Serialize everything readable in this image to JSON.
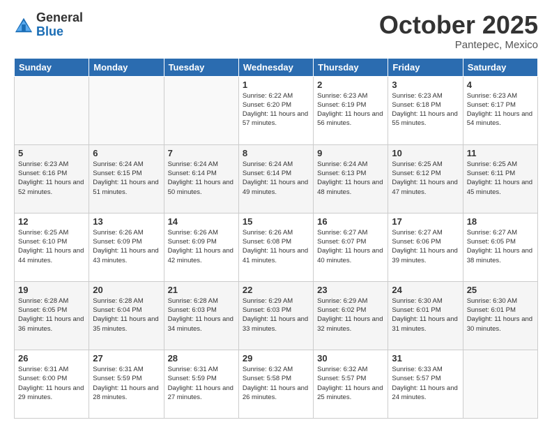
{
  "logo": {
    "general": "General",
    "blue": "Blue"
  },
  "header": {
    "month": "October 2025",
    "location": "Pantepec, Mexico"
  },
  "weekdays": [
    "Sunday",
    "Monday",
    "Tuesday",
    "Wednesday",
    "Thursday",
    "Friday",
    "Saturday"
  ],
  "weeks": [
    [
      {
        "day": "",
        "sunrise": "",
        "sunset": "",
        "daylight": ""
      },
      {
        "day": "",
        "sunrise": "",
        "sunset": "",
        "daylight": ""
      },
      {
        "day": "",
        "sunrise": "",
        "sunset": "",
        "daylight": ""
      },
      {
        "day": "1",
        "sunrise": "Sunrise: 6:22 AM",
        "sunset": "Sunset: 6:20 PM",
        "daylight": "Daylight: 11 hours and 57 minutes."
      },
      {
        "day": "2",
        "sunrise": "Sunrise: 6:23 AM",
        "sunset": "Sunset: 6:19 PM",
        "daylight": "Daylight: 11 hours and 56 minutes."
      },
      {
        "day": "3",
        "sunrise": "Sunrise: 6:23 AM",
        "sunset": "Sunset: 6:18 PM",
        "daylight": "Daylight: 11 hours and 55 minutes."
      },
      {
        "day": "4",
        "sunrise": "Sunrise: 6:23 AM",
        "sunset": "Sunset: 6:17 PM",
        "daylight": "Daylight: 11 hours and 54 minutes."
      }
    ],
    [
      {
        "day": "5",
        "sunrise": "Sunrise: 6:23 AM",
        "sunset": "Sunset: 6:16 PM",
        "daylight": "Daylight: 11 hours and 52 minutes."
      },
      {
        "day": "6",
        "sunrise": "Sunrise: 6:24 AM",
        "sunset": "Sunset: 6:15 PM",
        "daylight": "Daylight: 11 hours and 51 minutes."
      },
      {
        "day": "7",
        "sunrise": "Sunrise: 6:24 AM",
        "sunset": "Sunset: 6:14 PM",
        "daylight": "Daylight: 11 hours and 50 minutes."
      },
      {
        "day": "8",
        "sunrise": "Sunrise: 6:24 AM",
        "sunset": "Sunset: 6:14 PM",
        "daylight": "Daylight: 11 hours and 49 minutes."
      },
      {
        "day": "9",
        "sunrise": "Sunrise: 6:24 AM",
        "sunset": "Sunset: 6:13 PM",
        "daylight": "Daylight: 11 hours and 48 minutes."
      },
      {
        "day": "10",
        "sunrise": "Sunrise: 6:25 AM",
        "sunset": "Sunset: 6:12 PM",
        "daylight": "Daylight: 11 hours and 47 minutes."
      },
      {
        "day": "11",
        "sunrise": "Sunrise: 6:25 AM",
        "sunset": "Sunset: 6:11 PM",
        "daylight": "Daylight: 11 hours and 45 minutes."
      }
    ],
    [
      {
        "day": "12",
        "sunrise": "Sunrise: 6:25 AM",
        "sunset": "Sunset: 6:10 PM",
        "daylight": "Daylight: 11 hours and 44 minutes."
      },
      {
        "day": "13",
        "sunrise": "Sunrise: 6:26 AM",
        "sunset": "Sunset: 6:09 PM",
        "daylight": "Daylight: 11 hours and 43 minutes."
      },
      {
        "day": "14",
        "sunrise": "Sunrise: 6:26 AM",
        "sunset": "Sunset: 6:09 PM",
        "daylight": "Daylight: 11 hours and 42 minutes."
      },
      {
        "day": "15",
        "sunrise": "Sunrise: 6:26 AM",
        "sunset": "Sunset: 6:08 PM",
        "daylight": "Daylight: 11 hours and 41 minutes."
      },
      {
        "day": "16",
        "sunrise": "Sunrise: 6:27 AM",
        "sunset": "Sunset: 6:07 PM",
        "daylight": "Daylight: 11 hours and 40 minutes."
      },
      {
        "day": "17",
        "sunrise": "Sunrise: 6:27 AM",
        "sunset": "Sunset: 6:06 PM",
        "daylight": "Daylight: 11 hours and 39 minutes."
      },
      {
        "day": "18",
        "sunrise": "Sunrise: 6:27 AM",
        "sunset": "Sunset: 6:05 PM",
        "daylight": "Daylight: 11 hours and 38 minutes."
      }
    ],
    [
      {
        "day": "19",
        "sunrise": "Sunrise: 6:28 AM",
        "sunset": "Sunset: 6:05 PM",
        "daylight": "Daylight: 11 hours and 36 minutes."
      },
      {
        "day": "20",
        "sunrise": "Sunrise: 6:28 AM",
        "sunset": "Sunset: 6:04 PM",
        "daylight": "Daylight: 11 hours and 35 minutes."
      },
      {
        "day": "21",
        "sunrise": "Sunrise: 6:28 AM",
        "sunset": "Sunset: 6:03 PM",
        "daylight": "Daylight: 11 hours and 34 minutes."
      },
      {
        "day": "22",
        "sunrise": "Sunrise: 6:29 AM",
        "sunset": "Sunset: 6:03 PM",
        "daylight": "Daylight: 11 hours and 33 minutes."
      },
      {
        "day": "23",
        "sunrise": "Sunrise: 6:29 AM",
        "sunset": "Sunset: 6:02 PM",
        "daylight": "Daylight: 11 hours and 32 minutes."
      },
      {
        "day": "24",
        "sunrise": "Sunrise: 6:30 AM",
        "sunset": "Sunset: 6:01 PM",
        "daylight": "Daylight: 11 hours and 31 minutes."
      },
      {
        "day": "25",
        "sunrise": "Sunrise: 6:30 AM",
        "sunset": "Sunset: 6:01 PM",
        "daylight": "Daylight: 11 hours and 30 minutes."
      }
    ],
    [
      {
        "day": "26",
        "sunrise": "Sunrise: 6:31 AM",
        "sunset": "Sunset: 6:00 PM",
        "daylight": "Daylight: 11 hours and 29 minutes."
      },
      {
        "day": "27",
        "sunrise": "Sunrise: 6:31 AM",
        "sunset": "Sunset: 5:59 PM",
        "daylight": "Daylight: 11 hours and 28 minutes."
      },
      {
        "day": "28",
        "sunrise": "Sunrise: 6:31 AM",
        "sunset": "Sunset: 5:59 PM",
        "daylight": "Daylight: 11 hours and 27 minutes."
      },
      {
        "day": "29",
        "sunrise": "Sunrise: 6:32 AM",
        "sunset": "Sunset: 5:58 PM",
        "daylight": "Daylight: 11 hours and 26 minutes."
      },
      {
        "day": "30",
        "sunrise": "Sunrise: 6:32 AM",
        "sunset": "Sunset: 5:57 PM",
        "daylight": "Daylight: 11 hours and 25 minutes."
      },
      {
        "day": "31",
        "sunrise": "Sunrise: 6:33 AM",
        "sunset": "Sunset: 5:57 PM",
        "daylight": "Daylight: 11 hours and 24 minutes."
      },
      {
        "day": "",
        "sunrise": "",
        "sunset": "",
        "daylight": ""
      }
    ]
  ]
}
